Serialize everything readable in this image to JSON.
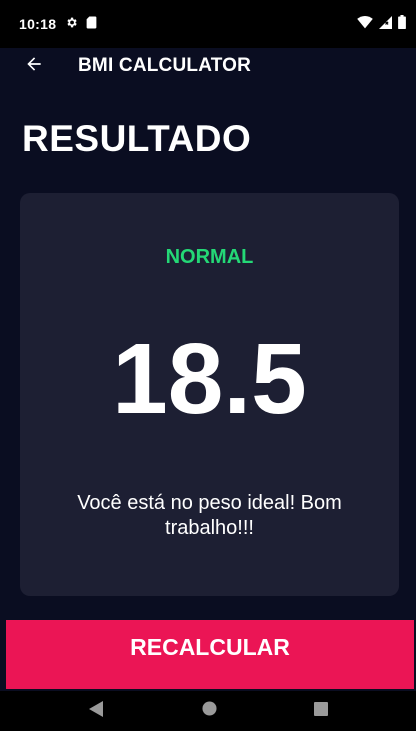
{
  "status_bar": {
    "time": "10:18",
    "left_icons": [
      "gear-icon",
      "sd-card-icon"
    ],
    "right_icons": [
      "wifi-icon",
      "cell-signal-icon",
      "battery-icon"
    ]
  },
  "app_bar": {
    "back_icon": "arrow-left-icon",
    "title": "BMI CALCULATOR"
  },
  "page": {
    "title": "RESULTADO"
  },
  "result": {
    "status": "NORMAL",
    "bmi": "18.5",
    "interpretation": "Você está no peso ideal! Bom trabalho!!!"
  },
  "recalculate_button": {
    "label": "RECALCULAR"
  },
  "nav_bar": {
    "buttons": [
      "back-triangle-icon",
      "home-circle-icon",
      "recents-square-icon"
    ]
  },
  "colors": {
    "background": "#0a0d21",
    "card": "#1d1f33",
    "status_green": "#24d876",
    "accent_pink": "#eb1555"
  }
}
